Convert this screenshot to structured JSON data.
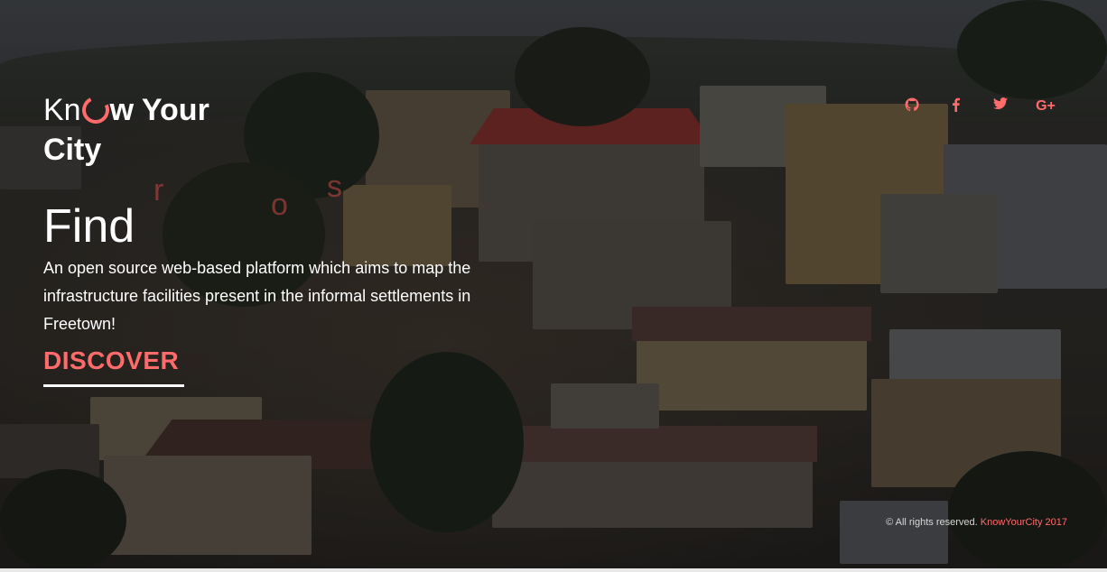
{
  "brand": {
    "logo_prefix": "Kn",
    "logo_suffix": "w Your",
    "logo_line2": "City",
    "accent_color": "#ff6b6b",
    "ring_icon": "ring-o-icon"
  },
  "ghost_letters": [
    "r",
    "o",
    "s"
  ],
  "hero": {
    "headline": "Find",
    "description": "An open source web-based platform which aims to map the infrastructure facilities present in the informal settlements in Freetown!",
    "cta_label": "DISCOVER"
  },
  "social": [
    {
      "name": "github",
      "icon": "github-icon"
    },
    {
      "name": "facebook",
      "icon": "facebook-icon"
    },
    {
      "name": "twitter",
      "icon": "twitter-icon"
    },
    {
      "name": "google-plus",
      "icon": "google-plus-icon",
      "label": "G+"
    }
  ],
  "footer": {
    "copyright": "© All rights reserved.",
    "brand_link": "KnowYourCity 2017"
  }
}
